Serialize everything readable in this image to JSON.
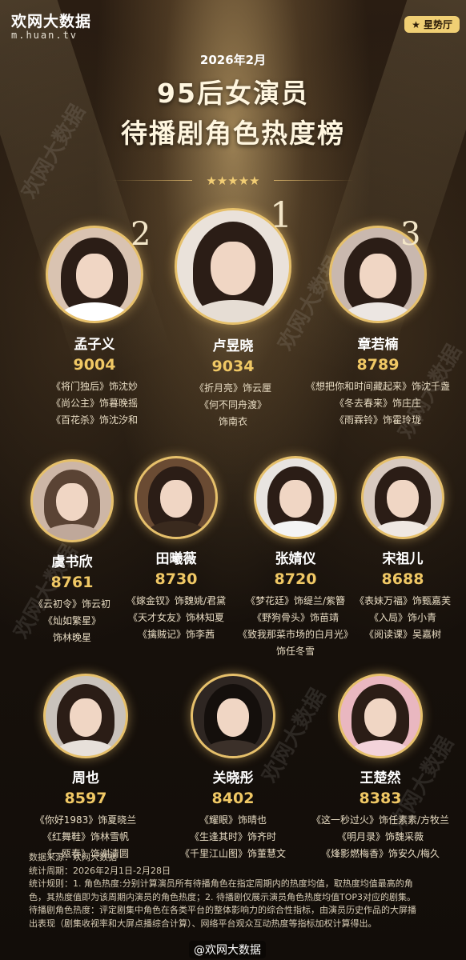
{
  "logo": {
    "brand": "欢网大数据",
    "domain": "m.huan.tv"
  },
  "tag": "★ 星势厅",
  "header": {
    "date": "2026年2月",
    "title_line1": "95后女演员",
    "title_line2": "待播剧角色热度榜",
    "stars": "★★★★★"
  },
  "top3": [
    {
      "rank": "2",
      "name": "孟子义",
      "score": "9004",
      "roles": [
        "《将门独后》饰沈妙",
        "《尚公主》饰暮晚摇",
        "《百花杀》饰沈汐和"
      ]
    },
    {
      "rank": "1",
      "name": "卢昱晓",
      "score": "9034",
      "roles": [
        "《折月亮》饰云厘",
        "《何不同舟渡》",
        "饰南衣"
      ]
    },
    {
      "rank": "3",
      "name": "章若楠",
      "score": "8789",
      "roles": [
        "《想把你和时间藏起来》饰沈千盏",
        "《冬去春来》饰庄庄",
        "《雨霖铃》饰霍玲珑"
      ]
    }
  ],
  "row2": [
    {
      "name": "虞书欣",
      "score": "8761",
      "roles": [
        "《云初令》饰云初",
        "《灿如繁星》",
        "饰林晚星"
      ]
    },
    {
      "name": "田曦薇",
      "score": "8730",
      "roles": [
        "《嫁金钗》饰魏姚/君黛",
        "《天才女友》饰林知夏",
        "《擒贼记》饰李茜"
      ]
    },
    {
      "name": "张婧仪",
      "score": "8720",
      "roles": [
        "《梦花廷》饰缇兰/紫簪",
        "《野狗骨头》饰苗靖",
        "《致我那菜市场的白月光》",
        "饰任冬雪"
      ]
    },
    {
      "name": "宋祖儿",
      "score": "8688",
      "roles": [
        "《表妹万福》饰甄嘉芙",
        "《入局》饰小青",
        "《阅读课》吴嘉树"
      ]
    }
  ],
  "row3": [
    {
      "name": "周也",
      "score": "8597",
      "roles": [
        "《你好1983》饰夏晓兰",
        "《红舞鞋》饰林雪帆",
        "《一瓯春》饰谢清圆"
      ]
    },
    {
      "name": "关晓彤",
      "score": "8402",
      "roles": [
        "《耀眼》饰晴也",
        "《生逢其时》饰齐时",
        "《千里江山图》饰董慧文"
      ]
    },
    {
      "name": "王楚然",
      "score": "8383",
      "roles": [
        "《这一秒过火》饰任素素/方牧兰",
        "《明月录》饰魏采薇",
        "《烽影燃梅香》饰安久/梅久"
      ]
    }
  ],
  "footer": {
    "lines": [
      "数据来源：欢网大数据",
      "统计周期：2026年2月1日-2月28日",
      "统计规则：1. 角色热度:分别计算演员所有待播角色在指定周期内的热度均值，取热度均值最高的角",
      "色，其热度值即为该周期内演员的角色热度；2. 待播剧仅展示演员角色热度均值TOP3对应的剧集。",
      "待播剧角色热度：评定剧集中角色在各类平台的整体影响力的综合性指标，由演员历史作品的大屏播",
      "出表现（剧集收视率和大屏点播综合计算）、网络平台观众互动热度等指标加权计算得出。"
    ],
    "weibo": "@欢网大数据"
  },
  "colors": {
    "accent": "#f0c865",
    "ring": "#e6c06b",
    "tag_bg": "#f0cf74"
  },
  "watermark": "欢网大数据"
}
